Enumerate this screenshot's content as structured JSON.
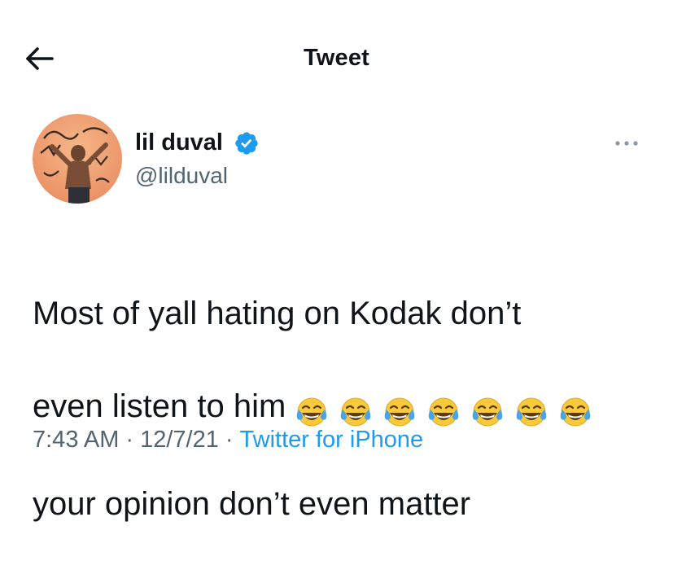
{
  "header": {
    "title": "Tweet",
    "back_icon": "arrow-left-icon"
  },
  "author": {
    "display_name": "lil duval",
    "handle": "@lilduval",
    "verified": true,
    "verified_color": "#1d9bf0"
  },
  "tweet": {
    "line1": "Most of yall hating on Kodak don’t",
    "line2": "even listen to him",
    "line3": "your opinion don’t even matter",
    "emoji_name": "face-with-tears-of-joy",
    "emoji_count": 7
  },
  "meta": {
    "time": "7:43 AM",
    "separator": "·",
    "date": "12/7/21",
    "source": "Twitter for iPhone",
    "link_color": "#1d9bf0"
  }
}
